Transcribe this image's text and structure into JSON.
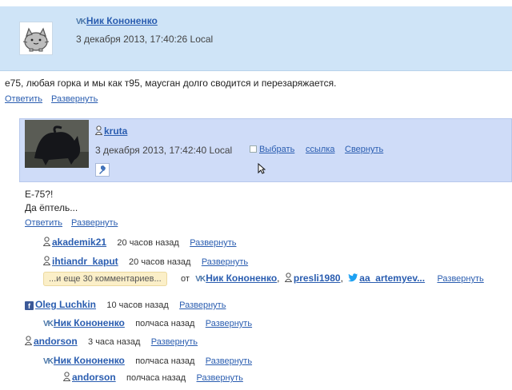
{
  "comment1": {
    "author": "Ник Кононенко",
    "date": "3 декабря 2013, 17:40:26 Local",
    "text": "е75, любая горка и мы как т95, маусган долго сводится и перезаряжается.",
    "reply": "Ответить",
    "expand": "Развернуть"
  },
  "comment2": {
    "author": "kruta",
    "date": "3 декабря 2013, 17:42:40 Local",
    "select": "Выбрать",
    "link": "ссылка",
    "collapse": "Свернуть",
    "text_line1": "Е-75?!",
    "text_line2": "Да ёптель...",
    "reply": "Ответить",
    "expand": "Развернуть"
  },
  "replies": [
    {
      "author": "akademik21",
      "time": "20 часов назад",
      "expand": "Развернуть"
    },
    {
      "author": "ihtiandr_kaput",
      "time": "20 часов назад",
      "expand": "Развернуть"
    }
  ],
  "more": {
    "label": "...и еще 30 комментариев...",
    "from": "от",
    "authors": [
      "Ник Кононенко",
      "presli1980",
      "aa_artemyev..."
    ],
    "expand": "Развернуть"
  },
  "thread": [
    {
      "author": "Oleg Luchkin",
      "time": "10 часов назад",
      "expand": "Развернуть",
      "network": "facebook"
    },
    {
      "author": "Ник Кононенко",
      "time": "полчаса назад",
      "expand": "Развернуть",
      "network": "vk"
    },
    {
      "author": "andorson",
      "time": "3 часа назад",
      "expand": "Развернуть",
      "network": "site"
    },
    {
      "author": "Ник Кононенко",
      "time": "полчаса назад",
      "expand": "Развернуть",
      "network": "vk"
    },
    {
      "author": "andorson",
      "time": "полчаса назад",
      "expand": "Развернуть",
      "network": "site"
    }
  ],
  "icons": {
    "vk": "vk-icon",
    "facebook": "facebook-icon",
    "twitter": "twitter-icon",
    "user": "user-icon",
    "pin": "pin-icon"
  }
}
